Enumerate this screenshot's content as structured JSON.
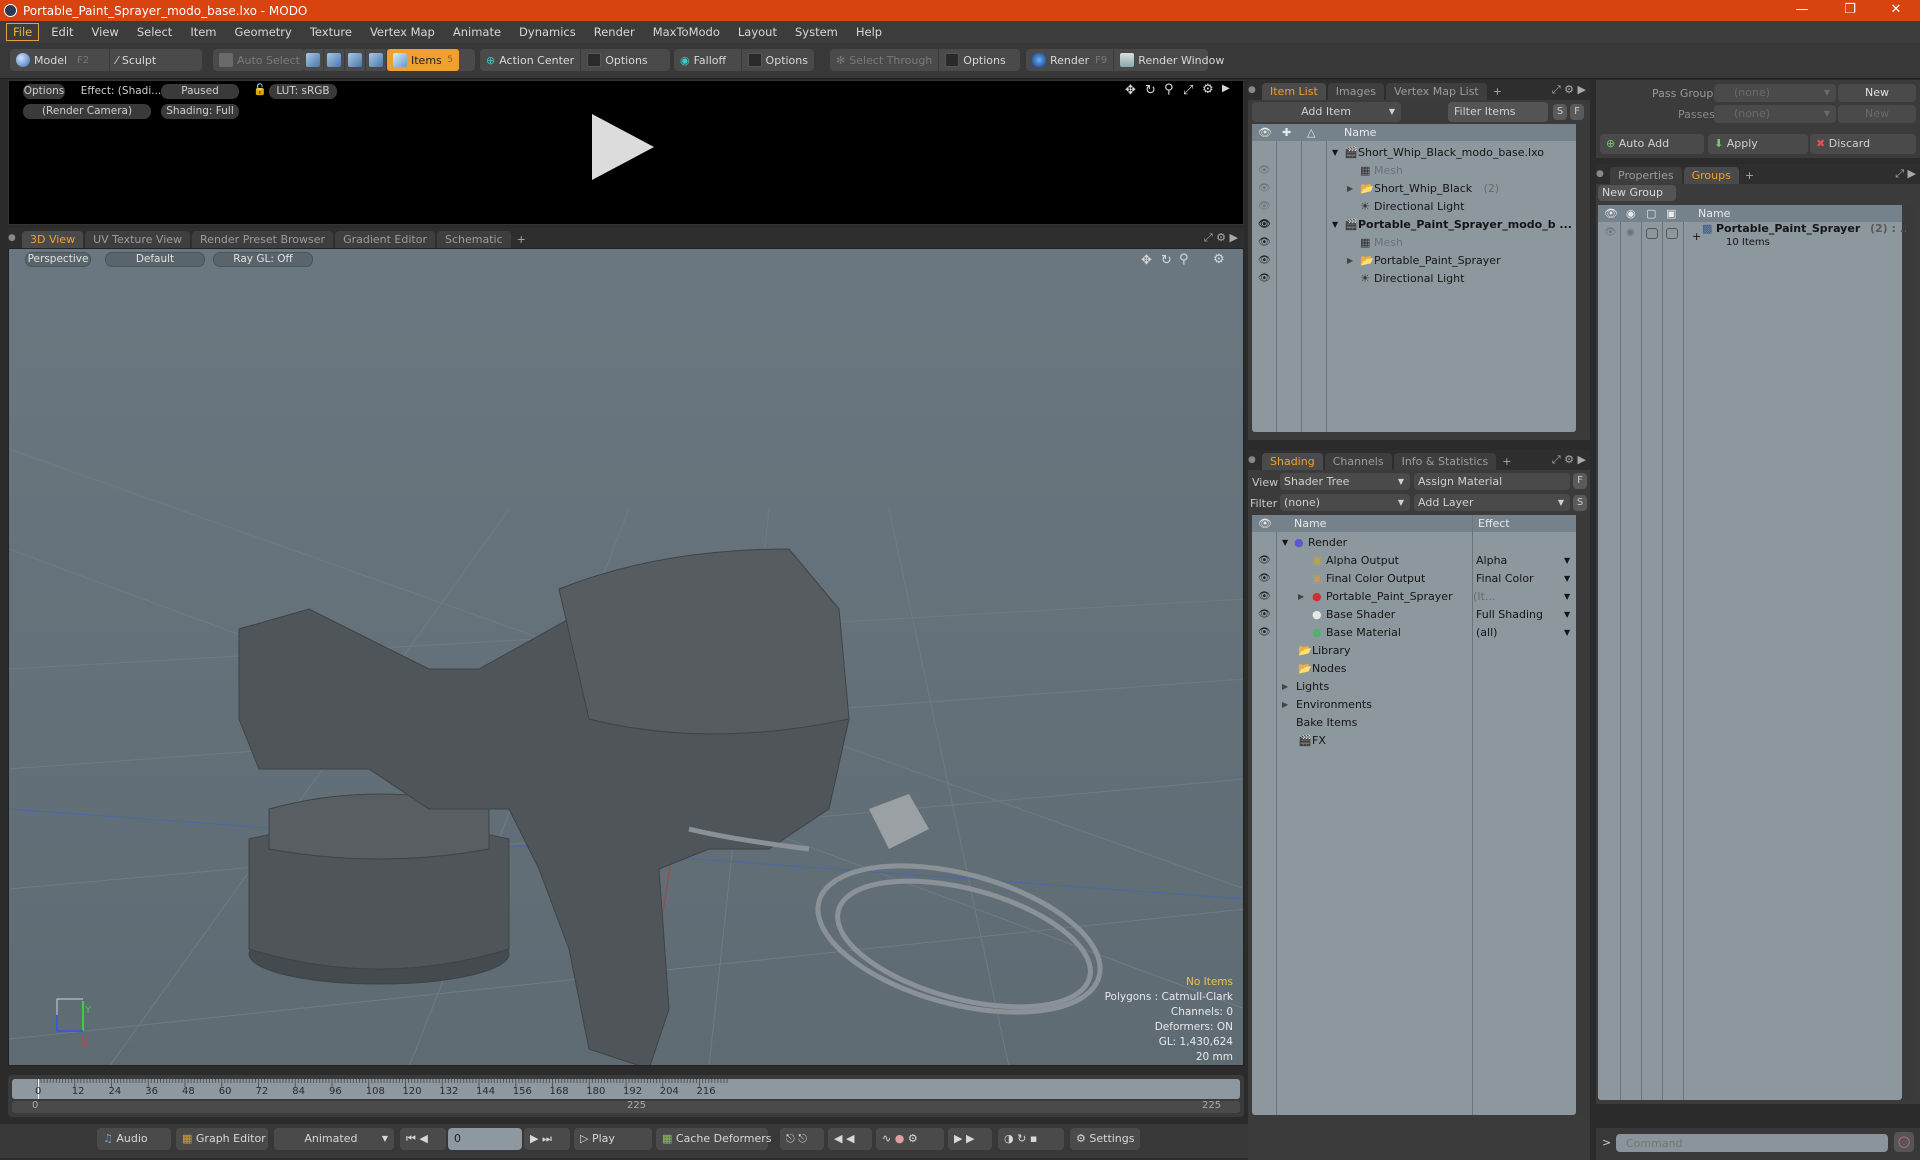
{
  "window": {
    "title": "Portable_Paint_Sprayer_modo_base.lxo - MODO",
    "controls": [
      "minimize",
      "restore",
      "close"
    ]
  },
  "menu": [
    "File",
    "Edit",
    "View",
    "Select",
    "Item",
    "Geometry",
    "Texture",
    "Vertex Map",
    "Animate",
    "Dynamics",
    "Render",
    "MaxToModo",
    "Layout",
    "System",
    "Help"
  ],
  "toolbar": {
    "model": "Model",
    "model_key": "F2",
    "sculpt": "Sculpt",
    "auto_select": "Auto Select",
    "items": "Items",
    "items_count": "5",
    "action_center": "Action Center",
    "options1": "Options",
    "falloff": "Falloff",
    "options2": "Options",
    "select_through": "Select Through",
    "options3": "Options",
    "render": "Render",
    "render_key": "F9",
    "render_window": "Render Window"
  },
  "render_preview": {
    "options": "Options",
    "effect": "Effect: (Shadi...",
    "status": "Paused",
    "lut": "LUT: sRGB",
    "camera": "(Render Camera)",
    "shading": "Shading: Full"
  },
  "viewport_tabs": [
    "3D View",
    "UV Texture View",
    "Render Preset Browser",
    "Gradient Editor",
    "Schematic",
    "+"
  ],
  "viewport": {
    "projection": "Perspective",
    "style": "Default",
    "raygl": "Ray GL: Off",
    "stats": {
      "items": "No Items",
      "polygons": "Polygons : Catmull-Clark",
      "channels": "Channels: 0",
      "deformers": "Deformers: ON",
      "gl": "GL: 1,430,624",
      "scale": "20 mm"
    },
    "axis": {
      "y": "Y",
      "x": "X"
    }
  },
  "timeline": {
    "ticks": [
      "0",
      "12",
      "24",
      "36",
      "48",
      "60",
      "72",
      "84",
      "96",
      "108",
      "120",
      "132",
      "144",
      "156",
      "168",
      "180",
      "192",
      "204",
      "216"
    ],
    "range_start": "0",
    "range_mid": "225",
    "range_end": "225"
  },
  "transport": {
    "audio": "Audio",
    "graph_editor": "Graph Editor",
    "mode": "Animated",
    "frame": "0",
    "play": "Play",
    "cache_deformers": "Cache Deformers",
    "settings": "Settings"
  },
  "item_list": {
    "tabs": [
      "Item List",
      "Images",
      "Vertex Map List",
      "+"
    ],
    "add_item": "Add Item",
    "filter_items": "Filter Items",
    "s": "S",
    "f": "F",
    "col_name": "Name",
    "rows": [
      {
        "label": "Short_Whip_Black_modo_base.lxo",
        "type": "scene",
        "visible": false,
        "bold": false
      },
      {
        "label": "Mesh",
        "type": "mesh",
        "visible": "faded",
        "dim": true
      },
      {
        "label": "Short_Whip_Black",
        "suffix": "(2)",
        "type": "group",
        "visible": "faded"
      },
      {
        "label": "Directional Light",
        "type": "light",
        "visible": "faded"
      },
      {
        "label": "Portable_Paint_Sprayer_modo_b ...",
        "type": "scene",
        "visible": true,
        "bold": true
      },
      {
        "label": "Mesh",
        "type": "mesh",
        "visible": true,
        "dim": true
      },
      {
        "label": "Portable_Paint_Sprayer",
        "type": "group",
        "visible": true
      },
      {
        "label": "Directional Light",
        "type": "light",
        "visible": true
      }
    ]
  },
  "pass_groups": {
    "pass_groups_label": "Pass Groups",
    "pass_groups_value": "(none)",
    "new1": "New",
    "passes_label": "Passes",
    "passes_value": "(none)",
    "new2": "New",
    "auto_add": "Auto Add",
    "apply": "Apply",
    "discard": "Discard"
  },
  "groups_panel": {
    "tabs": [
      "Properties",
      "Groups",
      "+"
    ],
    "new_group": "New Group",
    "col_name": "Name",
    "group": {
      "name": "Portable_Paint_Sprayer",
      "suffix": "(2) : ...",
      "count": "10 Items"
    }
  },
  "shading": {
    "tabs": [
      "Shading",
      "Channels",
      "Info & Statistics",
      "+"
    ],
    "view_label": "View",
    "view_value": "Shader Tree",
    "assign_material": "Assign Material",
    "f": "F",
    "filter_label": "Filter",
    "filter_value": "(none)",
    "add_layer": "Add Layer",
    "s": "S",
    "col_name": "Name",
    "col_effect": "Effect",
    "rows": [
      {
        "label": "Render",
        "effect": "",
        "icon": "render"
      },
      {
        "label": "Alpha Output",
        "effect": "Alpha",
        "icon": "output"
      },
      {
        "label": "Final Color Output",
        "effect": "Final Color",
        "icon": "output"
      },
      {
        "label": "Portable_Paint_Sprayer",
        "suffix": "(It...",
        "effect": "",
        "icon": "mask"
      },
      {
        "label": "Base Shader",
        "effect": "Full Shading",
        "icon": "shader"
      },
      {
        "label": "Base Material",
        "effect": "(all)",
        "icon": "material"
      },
      {
        "label": "Library",
        "effect": "",
        "icon": "folder"
      },
      {
        "label": "Nodes",
        "effect": "",
        "icon": "folder"
      },
      {
        "label": "Lights",
        "effect": "",
        "icon": "none"
      },
      {
        "label": "Environments",
        "effect": "",
        "icon": "none"
      },
      {
        "label": "Bake Items",
        "effect": "",
        "icon": "none"
      },
      {
        "label": "FX",
        "effect": "",
        "icon": "clapper"
      }
    ]
  },
  "command": {
    "placeholder": "Command",
    "prompt": ">"
  },
  "colors": {
    "title_bar": "#d84310",
    "accent": "#f0a030",
    "list_bg": "#8d979e"
  }
}
